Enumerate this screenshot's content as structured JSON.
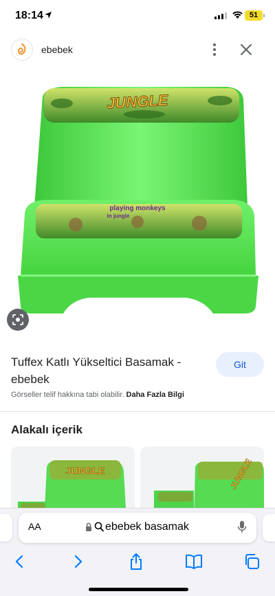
{
  "status_bar": {
    "time": "18:14",
    "battery": "51"
  },
  "site": {
    "name": "ebebek"
  },
  "product": {
    "title": "Tuffex Katlı Yükseltici Basamak - ebebek",
    "visit_label": "Git",
    "image_text_top": "JUNGLE",
    "image_text_step": "playing monkeys in jungle",
    "image_text_step_line1": "playing monkeys",
    "image_text_step_line2": "in jungle"
  },
  "copyright": {
    "text": "Görseller telif hakkına tabi olabilir.",
    "link": "Daha Fazla Bilgi"
  },
  "related": {
    "heading": "Alakalı içerik",
    "card_1_text": "JUNGLE",
    "card_2_text": "JUNGLE"
  },
  "safari": {
    "aa_label": "AA",
    "url": "ebebek basamak"
  },
  "colors": {
    "accent": "#0b57d0",
    "visit_bg": "#e8f0fe",
    "product_green": "#5ee35a",
    "toolbar_blue": "#007aff"
  },
  "icons": [
    "location-arrow-icon",
    "wifi-icon",
    "more-vert-icon",
    "close-icon",
    "lens-icon",
    "lock-icon",
    "search-icon",
    "mic-icon",
    "back-icon",
    "forward-icon",
    "share-icon",
    "bookmarks-icon",
    "tabs-icon"
  ]
}
